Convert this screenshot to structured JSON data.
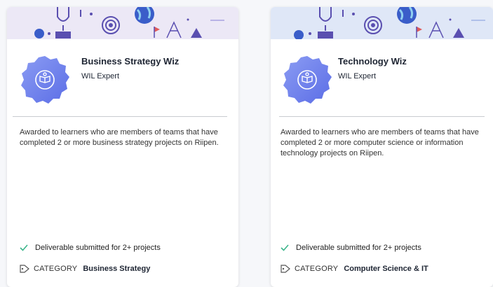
{
  "cards": [
    {
      "title": "Business Strategy Wiz",
      "subtitle": "WIL Expert",
      "description": "Awarded to learners who are members of teams that have completed 2 or more business strategy projects on Riipen.",
      "requirement": "Deliverable submitted for 2+ projects",
      "category_label": "CATEGORY",
      "category_value": "Business Strategy"
    },
    {
      "title": "Technology Wiz",
      "subtitle": "WIL Expert",
      "description": "Awarded to learners who are members of teams that have completed 2 or more computer science or information technology projects on Riipen.",
      "requirement": "Deliverable submitted for 2+ projects",
      "category_label": "CATEGORY",
      "category_value": "Computer Science & IT"
    }
  ],
  "icons": {
    "badge": "open-book-icon",
    "check": "check-icon",
    "tag": "tag-icon",
    "banner": [
      "trophy-icon",
      "target-icon",
      "globe-icon",
      "flag-icon",
      "pyramid-icon",
      "mountain-icon",
      "question-icon"
    ]
  },
  "colors": {
    "check": "#3bb58a",
    "badge_start": "#8b9cf3",
    "badge_end": "#5b6de6",
    "banner_card1": "#ece8f6",
    "banner_card2": "#dfe7f7",
    "banner_art": "#5a4fb0"
  }
}
